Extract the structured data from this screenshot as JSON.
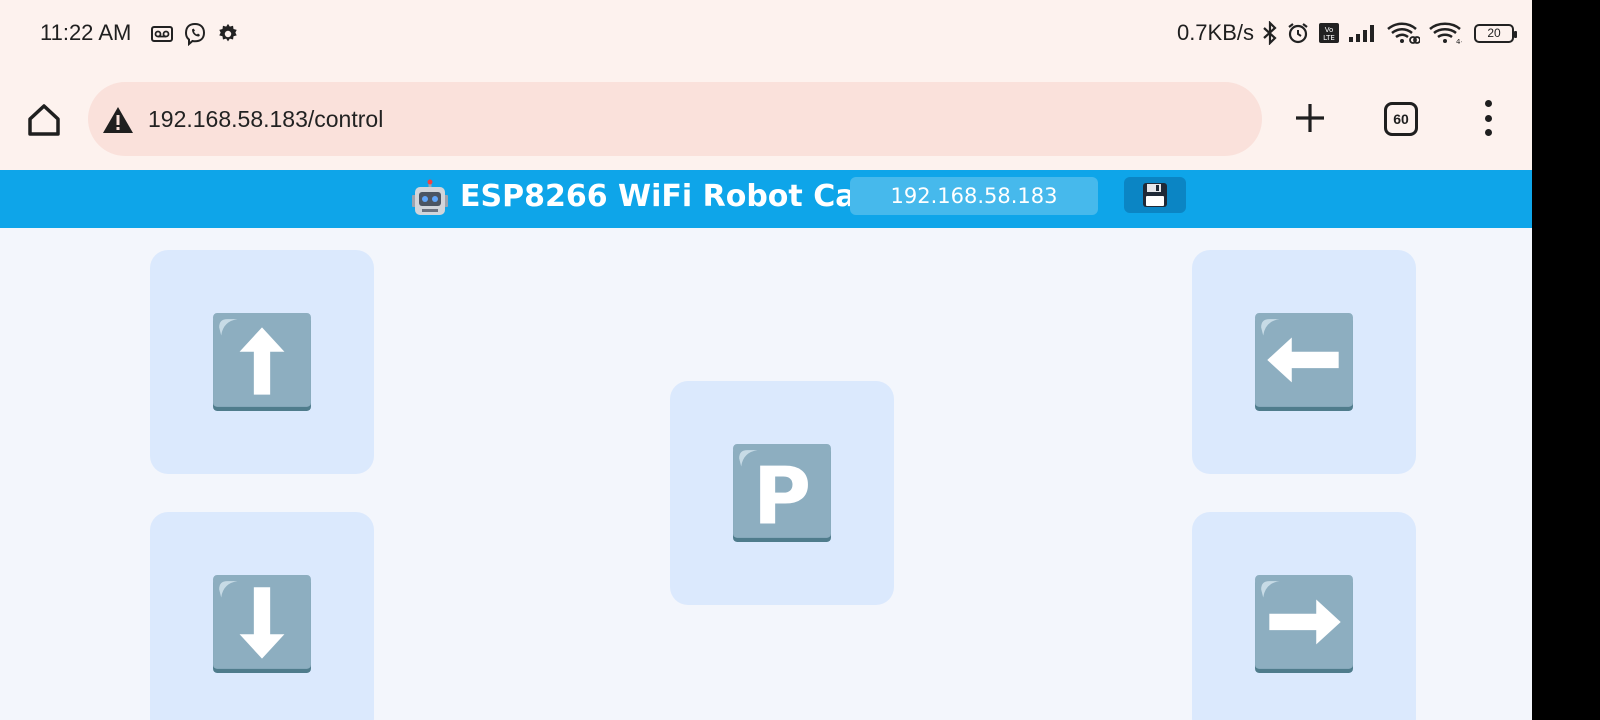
{
  "status_bar": {
    "time": "11:22 AM",
    "net_speed": "0.7KB/s",
    "battery": "20",
    "left_icons": [
      "voicemail-icon",
      "viber-icon",
      "gear-icon"
    ],
    "right_icons": [
      "bluetooth-icon",
      "alarm-icon",
      "volte-icon",
      "signal-icon",
      "wifi-link-icon",
      "wifi-icon",
      "battery-icon"
    ]
  },
  "browser": {
    "url": "192.168.58.183/control",
    "tab_count": "60"
  },
  "app": {
    "title": "ESP8266 WiFi Robot Car",
    "ip_value": "192.168.58.183",
    "accent": "#0ea5e9"
  },
  "controls": [
    {
      "id": "forward",
      "icon": "arrow-up-icon"
    },
    {
      "id": "backward",
      "icon": "arrow-down-icon"
    },
    {
      "id": "park",
      "label": "P",
      "icon": "parking-icon"
    },
    {
      "id": "left",
      "icon": "arrow-left-icon"
    },
    {
      "id": "right",
      "icon": "arrow-right-icon"
    }
  ]
}
